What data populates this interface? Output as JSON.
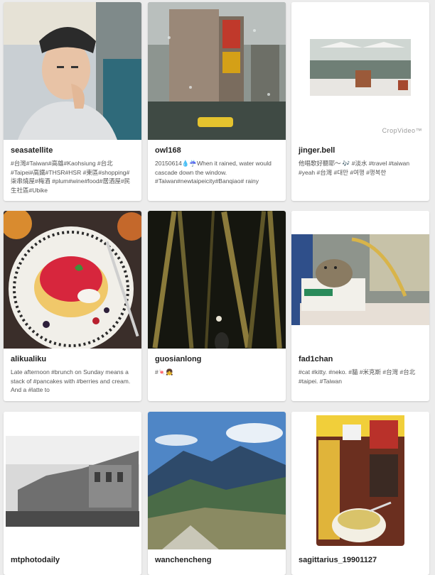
{
  "feed": {
    "cards": [
      {
        "username": "seasatellite",
        "caption": "#台灣#Taiwan#高雄#Kaohsiung #台北#Taipei#高鐵#THSR#HSR #東區#shopping#柒串燒屋#梅酒 #plum#wine#food#居酒屋#民生社區#Ubike"
      },
      {
        "username": "owl168",
        "caption": "20150614💧☔When it rained, water would cascade down the window. #Taiwan#newtaipeicity#Banqiao# rainy"
      },
      {
        "username": "jinger.bell",
        "caption": "他唱歌好聽耶～ 🎶 #淡水 #travel #taiwan #yeah #台灣 #대만 #여행 #행복한",
        "watermark": "CropVideo™"
      },
      {
        "username": "alikualiku",
        "caption": "Late afternoon #brunch on Sunday means a stack of #pancakes with #berries and cream. And a #latte to"
      },
      {
        "username": "guosianlong",
        "caption": "#🍬👧"
      },
      {
        "username": "fad1chan",
        "caption": "#cat #kitty. #neko. #貓 #米克斯 #台灣 #台北 #taipei. #Taiwan"
      },
      {
        "username": "mtphotodaily",
        "caption": ""
      },
      {
        "username": "wanchencheng",
        "caption": ""
      },
      {
        "username": "sagittarius_19901127",
        "caption": ""
      }
    ]
  }
}
